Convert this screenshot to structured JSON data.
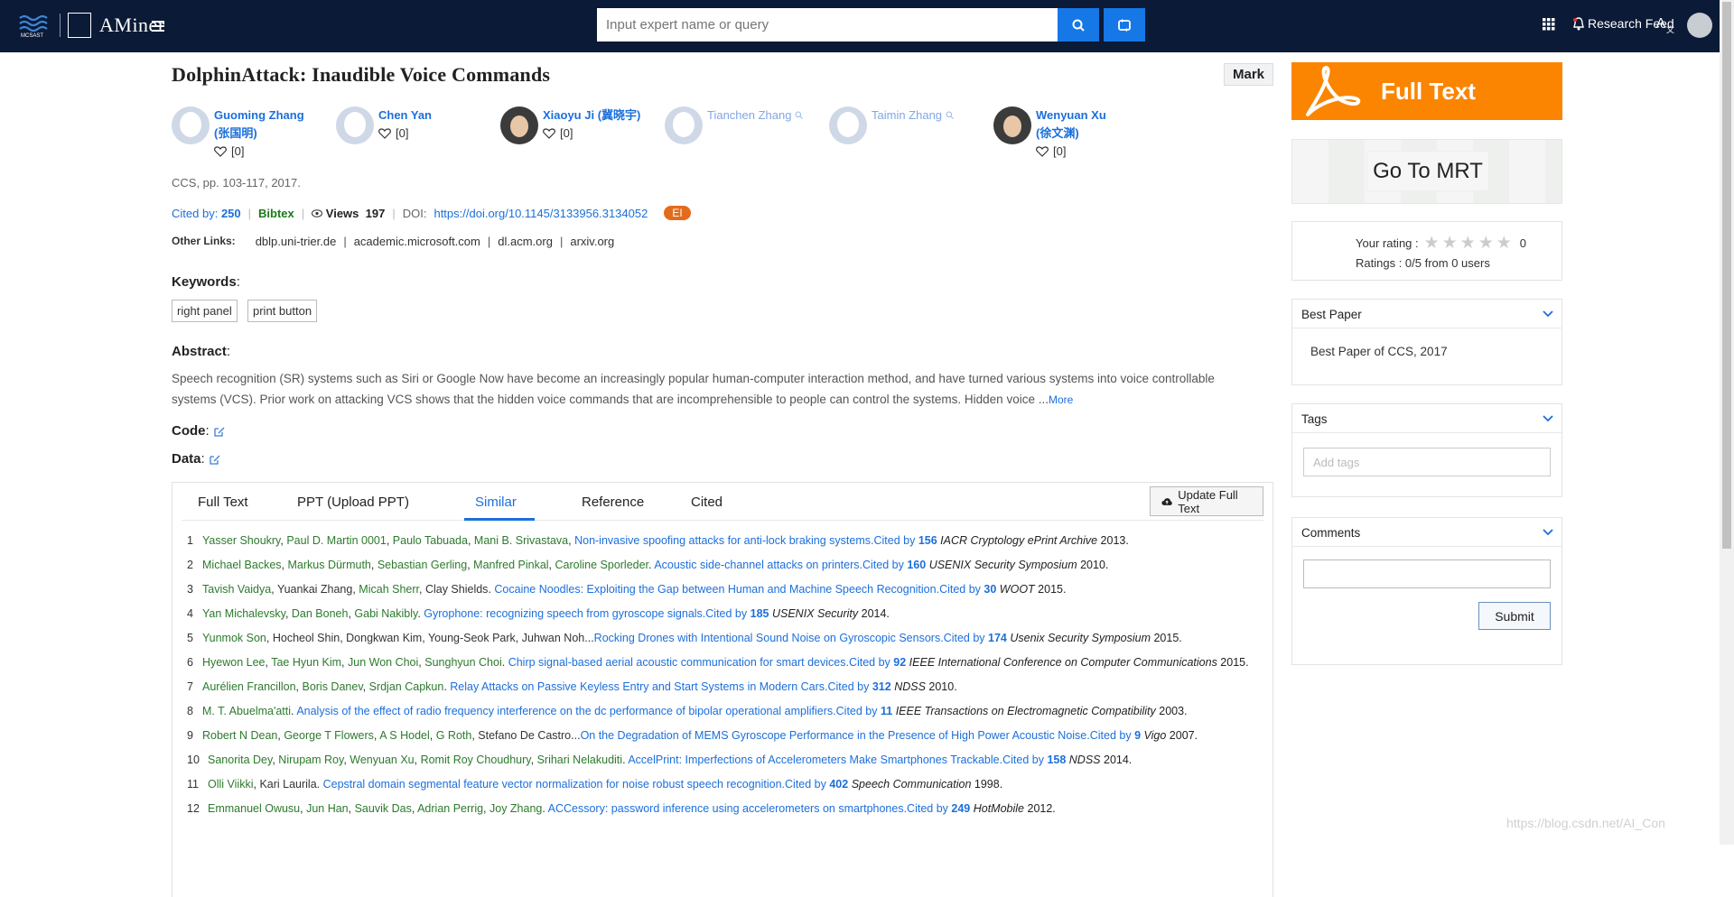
{
  "topbar": {
    "logo_text": "AMiner",
    "search_placeholder": "Input expert name or query",
    "feed_label": "Research Feed"
  },
  "paper": {
    "title": "DolphinAttack: Inaudible Voice Commands",
    "mark_label": "Mark",
    "authors": [
      {
        "name": "Guoming Zhang",
        "name2": "(张国明)",
        "likes": "[0]",
        "linked": true
      },
      {
        "name": "Chen Yan",
        "name2": "",
        "likes": "[0]",
        "linked": true
      },
      {
        "name": "Xiaoyu Ji (冀晓宇)",
        "name2": "",
        "likes": "[0]",
        "linked": true
      },
      {
        "name": "Tianchen Zhang",
        "name2": "",
        "likes": "",
        "linked": false
      },
      {
        "name": "Taimin Zhang",
        "name2": "",
        "likes": "",
        "linked": false
      },
      {
        "name": "Wenyuan Xu",
        "name2": "(徐文渊)",
        "likes": "[0]",
        "linked": true
      }
    ],
    "venue": "CCS, pp. 103-117, 2017.",
    "cited_label": "Cited by:",
    "cited_count": "250",
    "bibtex": "Bibtex",
    "views_label": "Views",
    "views_count": "197",
    "doi_label": "DOI:",
    "doi": "https://doi.org/10.1145/3133956.3134052",
    "ei_badge": "EI",
    "other_links_label": "Other Links:",
    "other_links": [
      "dblp.uni-trier.de",
      "academic.microsoft.com",
      "dl.acm.org",
      "arxiv.org"
    ],
    "keywords_label": "Keywords",
    "keywords": [
      "right panel",
      "print button"
    ],
    "abstract_label": "Abstract",
    "abstract_text": "Speech recognition (SR) systems such as Siri or Google Now have become an increasingly popular human-computer interaction method, and have turned various systems into voice controllable systems (VCS). Prior work on attacking VCS shows that the hidden voice commands that are incomprehensible to people can control the systems. Hidden voice ...",
    "abstract_more": "More",
    "code_label": "Code",
    "data_label": "Data"
  },
  "tabs": [
    "Full Text",
    "PPT (Upload PPT)",
    "Similar",
    "Reference",
    "Cited"
  ],
  "active_tab": "Similar",
  "update_button": "Update Full Text",
  "references": [
    {
      "n": "1",
      "parts": [
        [
          "au",
          "Yasser Shoukry"
        ],
        [
          "sep",
          ", "
        ],
        [
          "au",
          "Paul D. Martin 0001"
        ],
        [
          "sep",
          ", "
        ],
        [
          "au",
          "Paulo Tabuada"
        ],
        [
          "sep",
          ", "
        ],
        [
          "au",
          "Mani B. Srivastava"
        ],
        [
          "sep",
          ", "
        ],
        [
          "t",
          "Non-invasive spoofing attacks for anti-lock braking systems."
        ],
        [
          "c",
          "Cited by "
        ],
        [
          "cn",
          "156"
        ],
        [
          "v",
          "IACR Cryptology ePrint Archive"
        ],
        [
          "y",
          " 2013."
        ]
      ]
    },
    {
      "n": "2",
      "parts": [
        [
          "au",
          "Michael Backes"
        ],
        [
          "sep",
          ", "
        ],
        [
          "au",
          "Markus Dürmuth"
        ],
        [
          "sep",
          ", "
        ],
        [
          "au",
          "Sebastian Gerling"
        ],
        [
          "sep",
          ", "
        ],
        [
          "au",
          "Manfred Pinkal"
        ],
        [
          "sep",
          ", "
        ],
        [
          "au",
          "Caroline Sporleder"
        ],
        [
          "sep",
          "."
        ],
        [
          "t",
          " Acoustic side-channel attacks on printers."
        ],
        [
          "c",
          "Cited by "
        ],
        [
          "cn",
          "160"
        ],
        [
          "v",
          "USENIX Security Symposium"
        ],
        [
          "y",
          " 2010."
        ]
      ]
    },
    {
      "n": "3",
      "parts": [
        [
          "au",
          "Tavish Vaidya"
        ],
        [
          "sep",
          ", "
        ],
        [
          "pl",
          "Yuankai Zhang"
        ],
        [
          "sep",
          ", "
        ],
        [
          "au",
          "Micah Sherr"
        ],
        [
          "sep",
          ", "
        ],
        [
          "pl",
          "Clay Shields"
        ],
        [
          "sep",
          ". "
        ],
        [
          "t",
          "Cocaine Noodles: Exploiting the Gap between Human and Machine Speech Recognition."
        ],
        [
          "c",
          "Cited by "
        ],
        [
          "cn",
          "30"
        ],
        [
          "v",
          "WOOT"
        ],
        [
          "y",
          " 2015."
        ]
      ]
    },
    {
      "n": "4",
      "parts": [
        [
          "au",
          "Yan Michalevsky"
        ],
        [
          "sep",
          ", "
        ],
        [
          "au",
          "Dan Boneh"
        ],
        [
          "sep",
          ", "
        ],
        [
          "au",
          "Gabi Nakibly"
        ],
        [
          "sep",
          ". "
        ],
        [
          "t",
          "Gyrophone: recognizing speech from gyroscope signals."
        ],
        [
          "c",
          "Cited by "
        ],
        [
          "cn",
          "185"
        ],
        [
          "v",
          "USENIX Security"
        ],
        [
          "y",
          " 2014."
        ]
      ]
    },
    {
      "n": "5",
      "parts": [
        [
          "au",
          "Yunmok Son"
        ],
        [
          "sep",
          ", "
        ],
        [
          "pl",
          "Hocheol Shin"
        ],
        [
          "sep",
          ", "
        ],
        [
          "pl",
          "Dongkwan Kim"
        ],
        [
          "sep",
          ", "
        ],
        [
          "pl",
          "Young-Seok Park"
        ],
        [
          "sep",
          ", "
        ],
        [
          "pl",
          "Juhwan Noh"
        ],
        [
          "sep",
          "..."
        ],
        [
          "t",
          "Rocking Drones with Intentional Sound Noise on Gyroscopic Sensors."
        ],
        [
          "c",
          "Cited by "
        ],
        [
          "cn",
          "174"
        ],
        [
          "v",
          "Usenix Security Symposium"
        ],
        [
          "y",
          " 2015."
        ]
      ]
    },
    {
      "n": "6",
      "parts": [
        [
          "au",
          "Hyewon Lee"
        ],
        [
          "sep",
          ", "
        ],
        [
          "au",
          "Tae Hyun Kim"
        ],
        [
          "sep",
          ", "
        ],
        [
          "au",
          "Jun Won Choi"
        ],
        [
          "sep",
          ", "
        ],
        [
          "au",
          "Sunghyun Choi"
        ],
        [
          "sep",
          ". "
        ],
        [
          "t",
          "Chirp signal-based aerial acoustic communication for smart devices."
        ],
        [
          "c",
          "Cited by "
        ],
        [
          "cn",
          "92"
        ],
        [
          "v",
          "IEEE International Conference on Computer Communications"
        ],
        [
          "y",
          " 2015."
        ]
      ]
    },
    {
      "n": "7",
      "parts": [
        [
          "au",
          "Aurélien Francillon"
        ],
        [
          "sep",
          ", "
        ],
        [
          "au",
          "Boris Danev"
        ],
        [
          "sep",
          ", "
        ],
        [
          "au",
          "Srdjan Capkun"
        ],
        [
          "sep",
          ". "
        ],
        [
          "t",
          "Relay Attacks on Passive Keyless Entry and Start Systems in Modern Cars."
        ],
        [
          "c",
          "Cited by "
        ],
        [
          "cn",
          "312"
        ],
        [
          "v",
          "NDSS"
        ],
        [
          "y",
          " 2010."
        ]
      ]
    },
    {
      "n": "8",
      "parts": [
        [
          "au",
          "M. T. Abuelma'atti"
        ],
        [
          "sep",
          ". "
        ],
        [
          "t",
          "Analysis of the effect of radio frequency interference on the dc performance of bipolar operational amplifiers."
        ],
        [
          "c",
          "Cited by "
        ],
        [
          "cn",
          "11"
        ],
        [
          "v",
          "IEEE Transactions on Electromagnetic Compatibility"
        ],
        [
          "y",
          " 2003."
        ]
      ]
    },
    {
      "n": "9",
      "parts": [
        [
          "au",
          "Robert N Dean"
        ],
        [
          "sep",
          ", "
        ],
        [
          "au",
          "George T Flowers"
        ],
        [
          "sep",
          ", "
        ],
        [
          "au",
          "A S Hodel"
        ],
        [
          "sep",
          ", "
        ],
        [
          "au",
          "G Roth"
        ],
        [
          "sep",
          ", "
        ],
        [
          "pl",
          "Stefano De Castro"
        ],
        [
          "sep",
          "..."
        ],
        [
          "t",
          "On the Degradation of MEMS Gyroscope Performance in the Presence of High Power Acoustic Noise."
        ],
        [
          "c",
          "Cited by "
        ],
        [
          "cn",
          "9"
        ],
        [
          "v",
          "Vigo"
        ],
        [
          "y",
          " 2007."
        ]
      ]
    },
    {
      "n": "10",
      "parts": [
        [
          "au",
          "Sanorita Dey"
        ],
        [
          "sep",
          ", "
        ],
        [
          "au",
          "Nirupam Roy"
        ],
        [
          "sep",
          ", "
        ],
        [
          "au",
          "Wenyuan Xu"
        ],
        [
          "sep",
          ", "
        ],
        [
          "au",
          "Romit Roy Choudhury"
        ],
        [
          "sep",
          ", "
        ],
        [
          "au",
          "Srihari Nelakuditi"
        ],
        [
          "sep",
          ". "
        ],
        [
          "t",
          "AccelPrint: Imperfections of Accelerometers Make Smartphones Trackable."
        ],
        [
          "c",
          "Cited by "
        ],
        [
          "cn",
          "158"
        ],
        [
          "v",
          "NDSS"
        ],
        [
          "y",
          " 2014."
        ]
      ]
    },
    {
      "n": "11",
      "parts": [
        [
          "au",
          "Olli Viikki"
        ],
        [
          "sep",
          ", "
        ],
        [
          "pl",
          "Kari Laurila"
        ],
        [
          "sep",
          ". "
        ],
        [
          "t",
          "Cepstral domain segmental feature vector normalization for noise robust speech recognition."
        ],
        [
          "c",
          "Cited by "
        ],
        [
          "cn",
          "402"
        ],
        [
          "v",
          "Speech Communication"
        ],
        [
          "y",
          " 1998."
        ]
      ]
    },
    {
      "n": "12",
      "parts": [
        [
          "au",
          "Emmanuel Owusu"
        ],
        [
          "sep",
          ", "
        ],
        [
          "au",
          "Jun Han"
        ],
        [
          "sep",
          ", "
        ],
        [
          "au",
          "Sauvik Das"
        ],
        [
          "sep",
          ", "
        ],
        [
          "au",
          "Adrian Perrig"
        ],
        [
          "sep",
          ", "
        ],
        [
          "au",
          "Joy Zhang"
        ],
        [
          "sep",
          ". "
        ],
        [
          "t",
          "ACCessory: password inference using accelerometers on smartphones."
        ],
        [
          "c",
          "Cited by "
        ],
        [
          "cn",
          "249"
        ],
        [
          "v",
          "HotMobile"
        ],
        [
          "y",
          " 2012."
        ]
      ]
    }
  ],
  "sidebar": {
    "fulltext_label": "Full Text",
    "mrt_label": "Go To MRT",
    "your_rating_label": "Your rating :",
    "your_rating_value": "0",
    "your_rating_stars": 0,
    "ratings_summary": "Ratings : 0/5 from 0 users",
    "best_paper_header": "Best Paper",
    "best_paper_text": "Best Paper of CCS, 2017",
    "tags_header": "Tags",
    "tags_placeholder": "Add tags",
    "comments_header": "Comments",
    "submit_label": "Submit"
  },
  "watermark": "https://blog.csdn.net/AI_Con",
  "colors": {
    "navbar": "#0b1a36",
    "accent": "#1b6fdb",
    "fulltext": "#fb8500",
    "author_green": "#2d7a2d"
  }
}
